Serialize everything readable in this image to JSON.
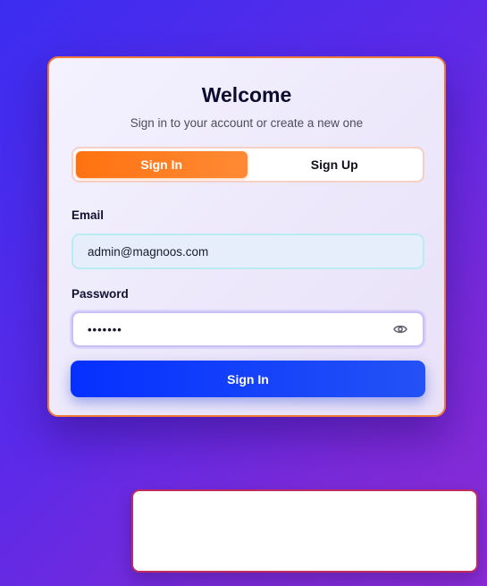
{
  "auth": {
    "title": "Welcome",
    "subtitle": "Sign in to your account or create a new one",
    "tabs": [
      {
        "label": "Sign In",
        "active": true
      },
      {
        "label": "Sign Up",
        "active": false
      }
    ],
    "email": {
      "label": "Email",
      "value": "admin@magnoos.com"
    },
    "password": {
      "label": "Password",
      "masked_value": "•••••••",
      "toggle_icon": "eye-icon"
    },
    "submit_label": "Sign In"
  },
  "colors": {
    "background_start": "#3b2df0",
    "background_end": "#8a2bd6",
    "card_border": "#f07a3a",
    "active_tab": "#ff7210",
    "primary_button": "#0530ff",
    "toast_border": "#c02a5f"
  },
  "toast": {
    "message": ""
  }
}
